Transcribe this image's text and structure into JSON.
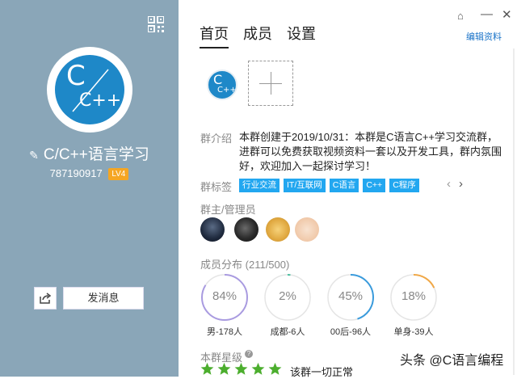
{
  "left_panel": {
    "group_name": "C/C++语言学习",
    "group_id": "787190917",
    "level": "LV4",
    "send_message_label": "发消息",
    "avatar_text_top": "C",
    "avatar_text_bottom": "C++"
  },
  "tabs": [
    {
      "label": "首页",
      "active": true
    },
    {
      "label": "成员",
      "active": false
    },
    {
      "label": "设置",
      "active": false
    }
  ],
  "edit_profile_label": "编辑资料",
  "intro": {
    "label": "群介绍",
    "text": "本群创建于2019/10/31：本群是C语言C++学习交流群，进群可以免费获取视频资料一套以及开发工具，群内氛围好，欢迎加入一起探讨学习！"
  },
  "tags": {
    "label": "群标签",
    "items": [
      "行业交流",
      "IT/互联网",
      "C语言",
      "C++",
      "C程序"
    ]
  },
  "admins_label": "群主/管理员",
  "distribution": {
    "label": "成员分布",
    "count": "(211/500)",
    "items": [
      {
        "percent": "84%",
        "label": "男-178人",
        "value": 0.84,
        "color": "#a99be0"
      },
      {
        "percent": "2%",
        "label": "成都-6人",
        "value": 0.02,
        "color": "#4dbfa0"
      },
      {
        "percent": "45%",
        "label": "00后-96人",
        "value": 0.45,
        "color": "#3a9bdc"
      },
      {
        "percent": "18%",
        "label": "单身-39人",
        "value": 0.18,
        "color": "#f0a848"
      }
    ]
  },
  "rating": {
    "label": "本群星级",
    "stars": 5,
    "status": "该群一切正常",
    "star_color": "#4cae2e"
  },
  "watermark": "头条 @C语言编程",
  "colors": {
    "left_panel": "#8aa6b8",
    "tag": "#22a7f0",
    "link": "#1a73c8",
    "level_badge": "#f5a623"
  }
}
